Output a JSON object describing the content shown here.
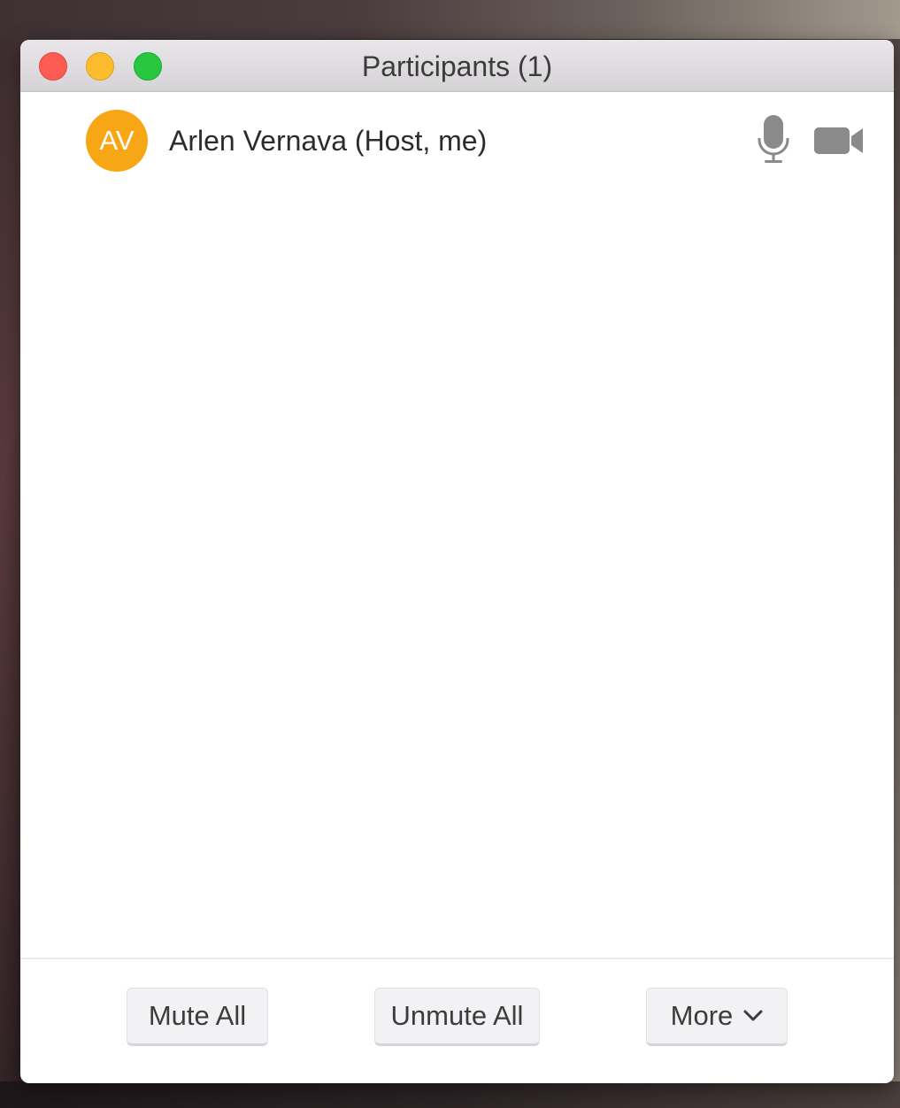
{
  "window": {
    "title": "Participants (1)"
  },
  "participants": [
    {
      "initials": "AV",
      "name": "Arlen Vernava (Host, me)",
      "avatar_color": "#f7a616",
      "mic_icon": "microphone-icon",
      "video_icon": "video-camera-icon"
    }
  ],
  "footer": {
    "mute_all_label": "Mute All",
    "unmute_all_label": "Unmute All",
    "more_label": "More",
    "more_icon": "chevron-down-icon"
  },
  "colors": {
    "close": "#fd5c55",
    "minimize": "#fdbc2e",
    "zoom": "#27c840",
    "avatar": "#f7a616",
    "icon_gray": "#8a8a8a"
  }
}
